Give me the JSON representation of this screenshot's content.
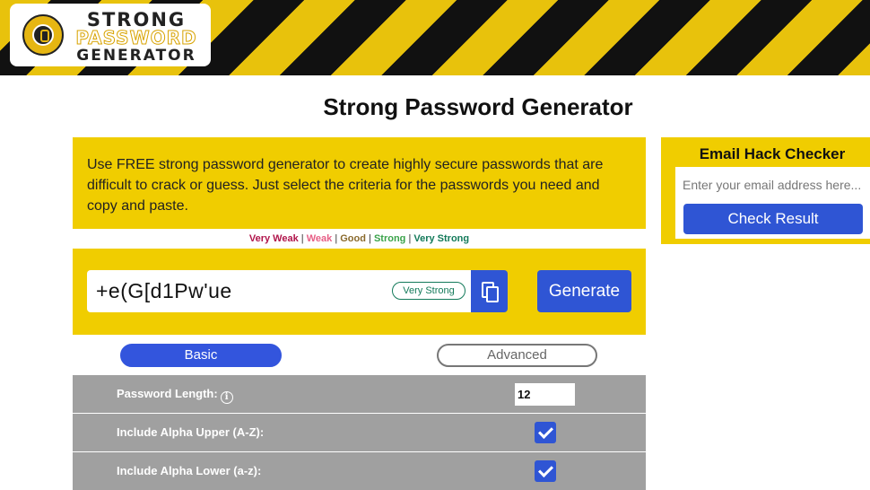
{
  "header": {
    "logo_line1": "STRONG",
    "logo_line2": "PASSWORD",
    "logo_line3": "GENERATOR",
    "pattern_colors": [
      "#e8c20c",
      "#111111"
    ]
  },
  "page_title": "Strong Password Generator",
  "intro_text": "Use FREE strong password generator to create highly secure passwords that are difficult to crack or guess. Just select the criteria for the passwords you need and copy and paste.",
  "strength_legend": {
    "levels": [
      "Very Weak",
      "Weak",
      "Good",
      "Strong",
      "Very Strong"
    ],
    "separator": "|",
    "colors": [
      "#b0154b",
      "#e75f86",
      "#8a6a2c",
      "#3aa34a",
      "#137a5a"
    ]
  },
  "generator": {
    "password": "+e(G[d1Pw'ue",
    "strength": "Very Strong",
    "copy_icon": "copy-icon",
    "generate_label": "Generate"
  },
  "tabs": {
    "basic": "Basic",
    "advanced": "Advanced",
    "active": "Basic"
  },
  "options": [
    {
      "label": "Password Length:",
      "type": "number",
      "value": "12",
      "info_icon": "i"
    },
    {
      "label": "Include Alpha Upper (A-Z):",
      "type": "checkbox",
      "checked": true
    },
    {
      "label": "Include Alpha Lower (a-z):",
      "type": "checkbox",
      "checked": true
    }
  ],
  "hack_checker": {
    "title": "Email Hack Checker",
    "placeholder": "Enter your email address here...",
    "button": "Check Result"
  },
  "colors": {
    "accent_yellow": "#f0cd00",
    "button_blue": "#2f55d4",
    "row_gray": "#a0a0a0"
  }
}
